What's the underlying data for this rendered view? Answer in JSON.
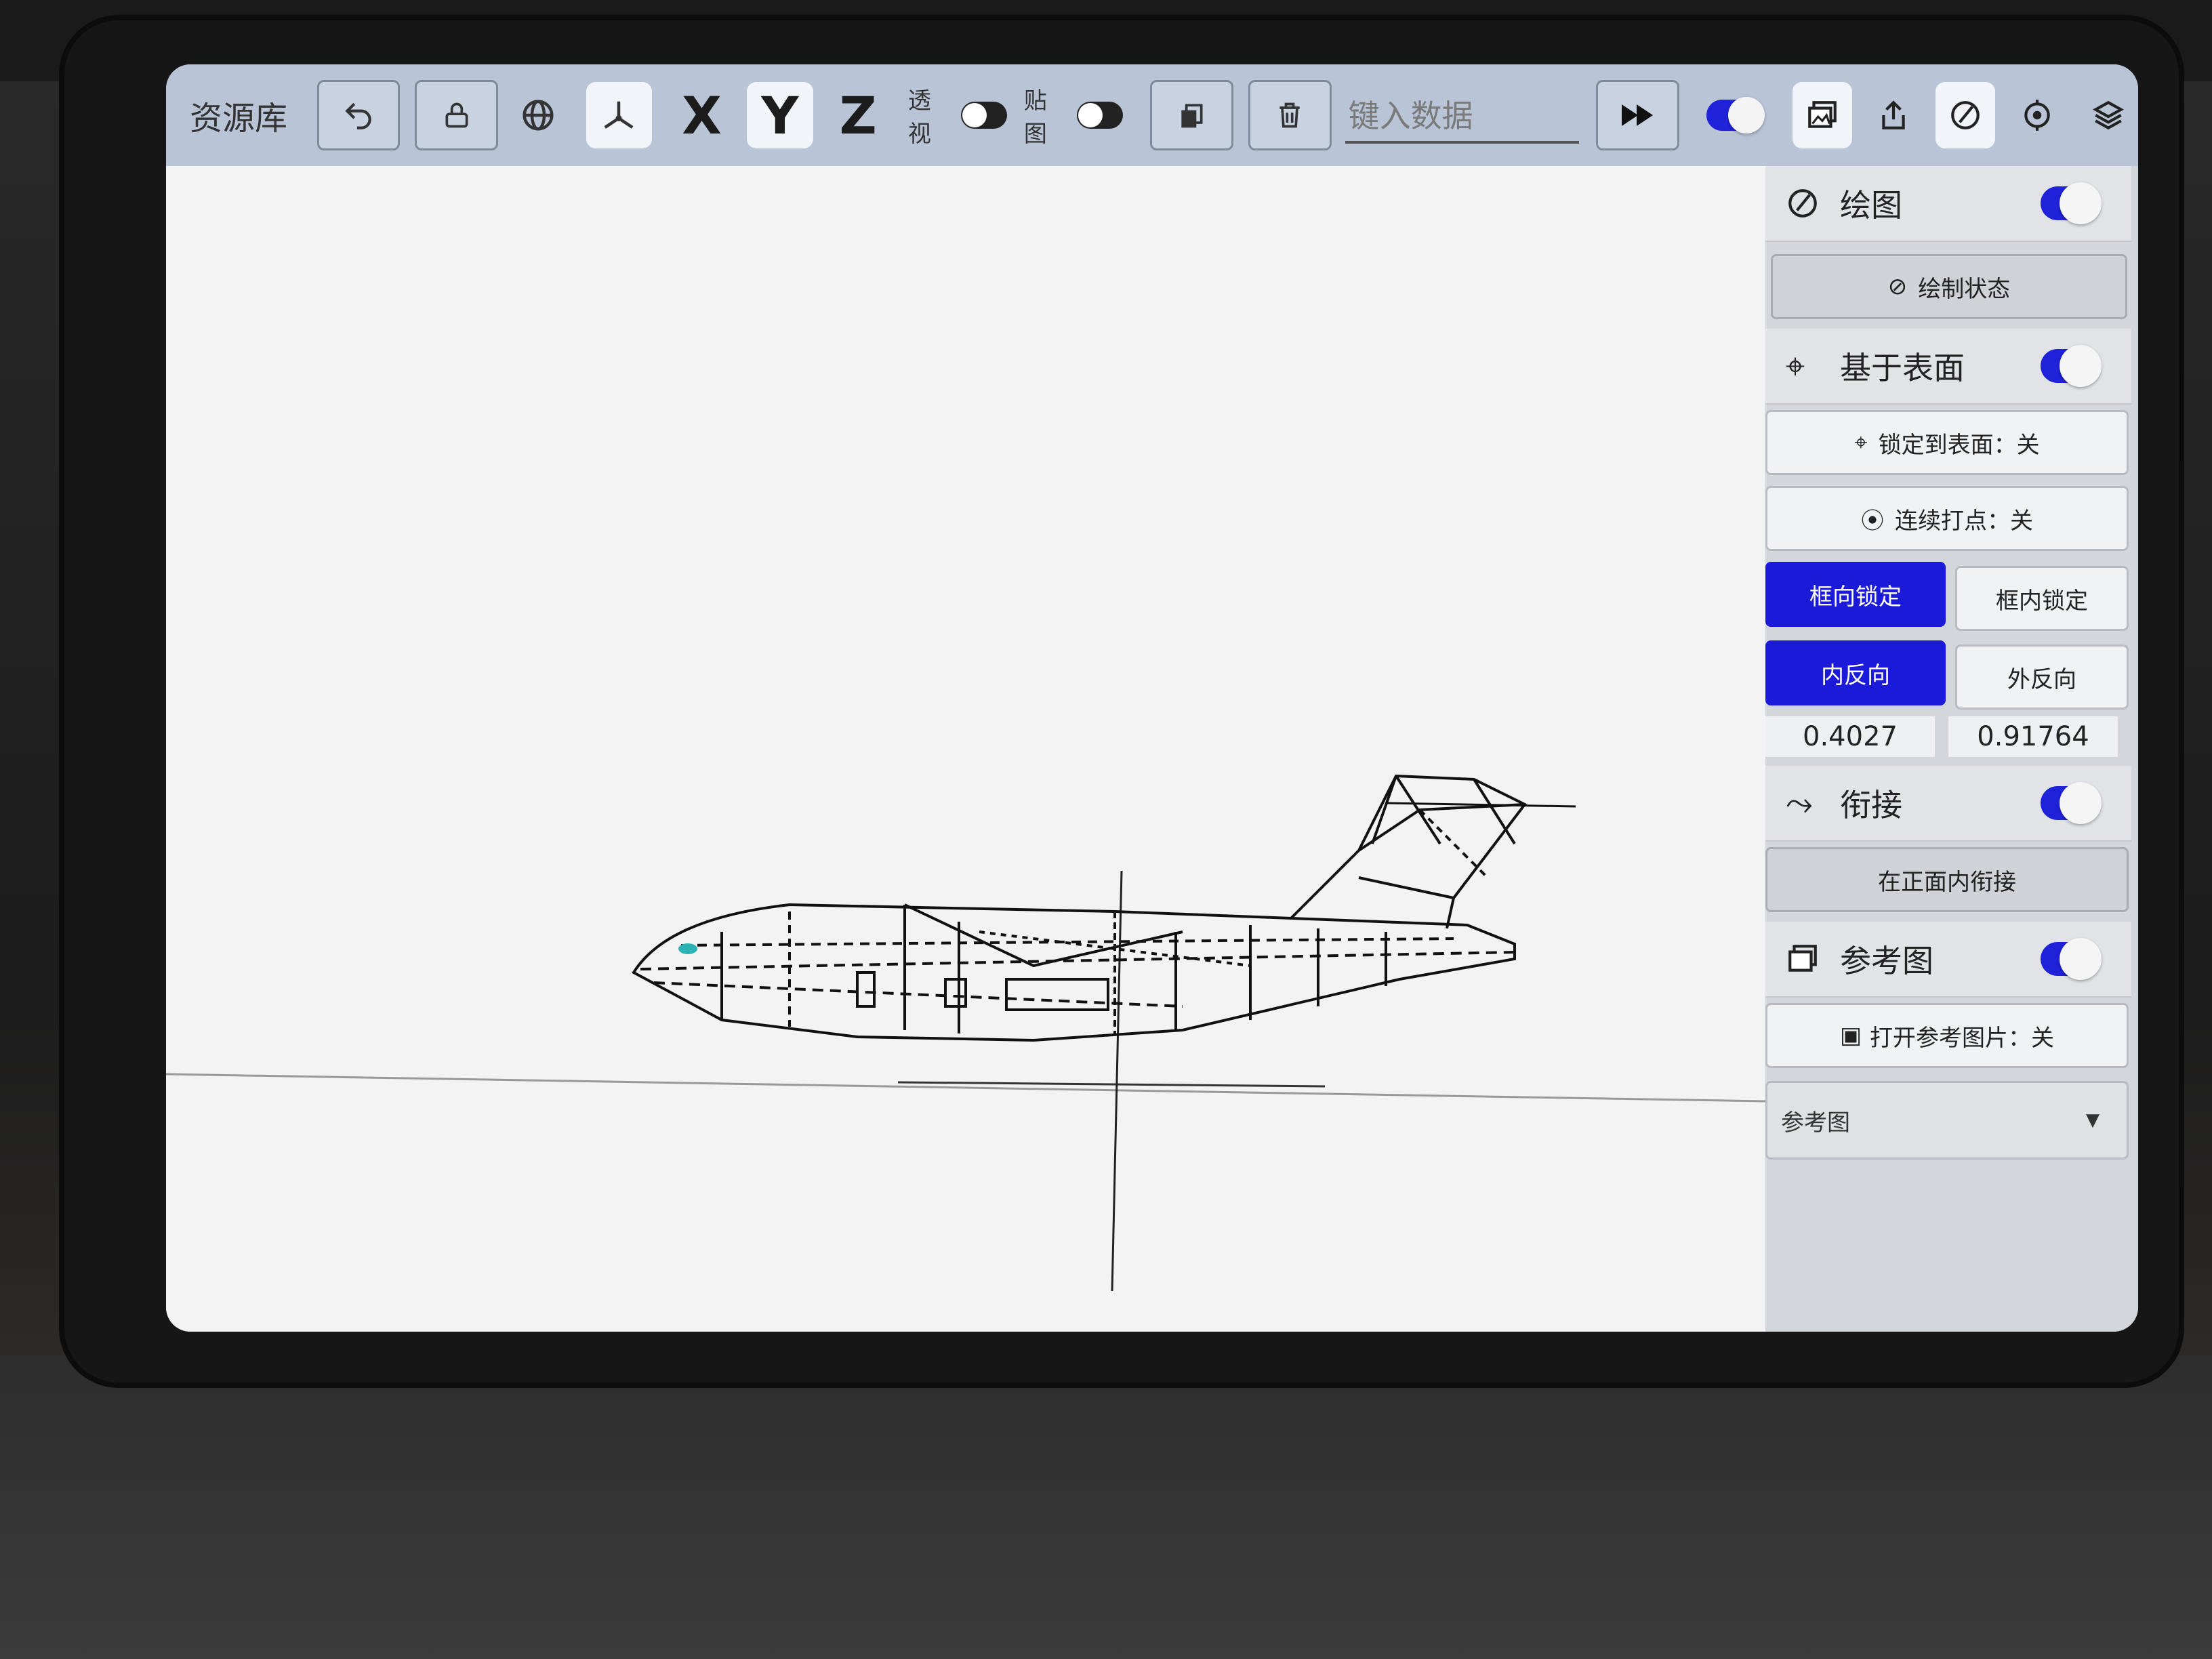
{
  "toolbar": {
    "title": "资源库",
    "undo_icon": "undo-icon",
    "lock_icon": "lock-icon",
    "globe_icon": "globe-icon",
    "axes_icon": "axes-icon",
    "axis_x": "X",
    "axis_y": "Y",
    "axis_z": "Z",
    "perspective_label": "透视",
    "texture_label": "贴图",
    "input_placeholder": "键入数据"
  },
  "panel": {
    "draw": {
      "title": "绘图",
      "state_button": "绘制状态"
    },
    "surface": {
      "title": "基于表面",
      "lock_surface": "锁定到表面：关",
      "continuous_points": "连续打点：关"
    },
    "lock_modes": [
      "框向锁定",
      "框内锁定"
    ],
    "directions": [
      "内反向",
      "外反向"
    ],
    "values": [
      "0.4027",
      "0.91764"
    ],
    "link": {
      "title": "衔接",
      "button": "在正面内衔接"
    },
    "reference": {
      "title": "参考图",
      "open_button": "打开参考图片：关",
      "dropdown_value": "参考图"
    }
  },
  "colors": {
    "accent": "#1c1ad9",
    "toolbar_bg": "#b9c5d7"
  }
}
